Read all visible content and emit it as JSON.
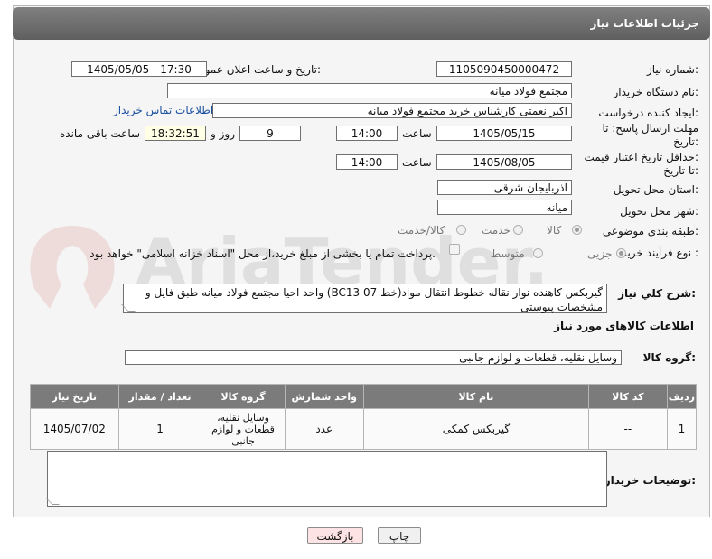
{
  "page_title": "جزئیات اطلاعات نیاز",
  "fields": {
    "need_number_label": "شماره نیاز:",
    "need_number": "1105090450000472",
    "announce_label": "تاریخ و ساعت اعلان عمومی:",
    "announce_value": "1405/05/05 - 17:30",
    "buyer_org_label": "نام دستگاه خریدار:",
    "buyer_org": "مجتمع فولاد میانه",
    "creator_label": "ایجاد کننده درخواست:",
    "creator": "اکبر نعمتی کارشناس خرید مجتمع فولاد میانه",
    "contact_link": "اطلاعات تماس خریدار",
    "reply_deadline_label_1": "مهلت ارسال پاسخ: تا",
    "reply_deadline_label_2": "تاریخ:",
    "reply_date": "1405/05/15",
    "time_label": "ساعت",
    "reply_time": "14:00",
    "days": "9",
    "days_label": "روز و",
    "remaining_time": "18:32:51",
    "remaining_label": "ساعت باقی مانده",
    "price_validity_label_1": "حداقل تاریخ اعتبار قیمت:",
    "price_validity_label_2": "تا تاریخ:",
    "price_date": "1405/08/05",
    "price_time": "14:00",
    "province_label": "استان محل تحویل:",
    "province": "آذربایجان شرقی",
    "city_label": "شهر محل تحویل:",
    "city": "میانه",
    "category_label": "طبقه بندی موضوعی:",
    "category_options": [
      "کالا",
      "خدمت",
      "کالا/خدمت"
    ],
    "process_label": "نوع فرآیند خرید :",
    "process_options": [
      "جزیی",
      "متوسط"
    ],
    "payment_note": "پرداخت تمام یا بخشی از مبلغ خرید،از محل \"اسناد خزانه اسلامی\" خواهد بود."
  },
  "description": {
    "label": "شرح کلي نياز:",
    "text": "گیربکس کاهنده نوار نقاله خطوط انتقال مواد(خط BC13 07) واحد احیا مجتمع فولاد میانه طبق فایل و مشخصات پیوستی"
  },
  "goods": {
    "section_title": "اطلاعات کالاهای مورد نياز",
    "group_label": "گروه کالا:",
    "group_value": "وسایل نقلیه، قطعات و لوازم جانبی",
    "columns": [
      "ردیف",
      "کد کالا",
      "نام کالا",
      "واحد شمارش",
      "گروه کالا",
      "تعداد / مقدار",
      "تاریخ نیاز"
    ],
    "rows": [
      [
        "1",
        "--",
        "گیربکس کمکی",
        "عدد",
        "وسایل نقلیه، قطعات و لوازم جانبی",
        "1",
        "1405/07/02"
      ]
    ]
  },
  "buyer_notes_label": "توضیحات خریدار:",
  "buttons": {
    "print": "چاپ",
    "back": "بازگشت"
  },
  "watermark_text": "AriaTender.net"
}
